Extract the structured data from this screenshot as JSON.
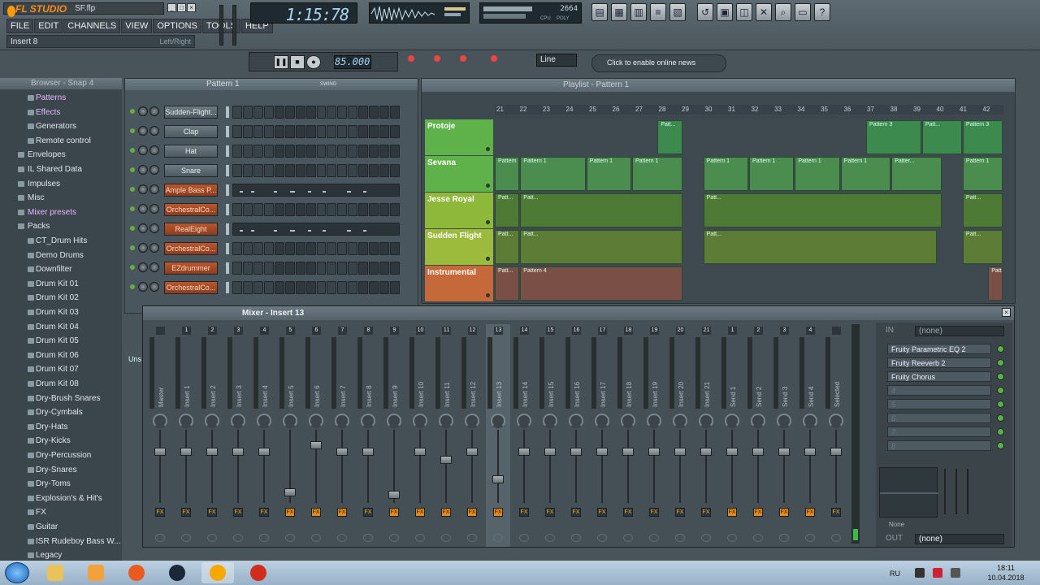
{
  "app": {
    "logo_text": "FL STUDIO",
    "file_name": "SF.flp",
    "menu": [
      "FILE",
      "EDIT",
      "CHANNELS",
      "VIEW",
      "OPTIONS",
      "TOOLS",
      "HELP"
    ],
    "hint_left": "Insert 8",
    "hint_right": "Left/Right",
    "time_display": "1:15:78",
    "memory": "2664",
    "cpu_label": "CPU",
    "poly_label": "POLY",
    "tempo": "85.000",
    "snap_mode": "Line",
    "online_text": "Click to enable online news"
  },
  "browser": {
    "title": "Browser - Snap 4",
    "items": [
      {
        "label": "Patterns",
        "level": 1,
        "hl": true
      },
      {
        "label": "Effects",
        "level": 1,
        "hl": true
      },
      {
        "label": "Generators",
        "level": 1,
        "hl": false
      },
      {
        "label": "Remote control",
        "level": 1,
        "hl": false
      },
      {
        "label": "Envelopes",
        "level": 0,
        "hl": false
      },
      {
        "label": "IL Shared Data",
        "level": 0,
        "hl": false
      },
      {
        "label": "Impulses",
        "level": 0,
        "hl": false
      },
      {
        "label": "Misc",
        "level": 0,
        "hl": false
      },
      {
        "label": "Mixer presets",
        "level": 0,
        "hl": true
      },
      {
        "label": "Packs",
        "level": 0,
        "hl": false
      },
      {
        "label": "CT_Drum Hits",
        "level": 1,
        "hl": false
      },
      {
        "label": "Demo Drums",
        "level": 1,
        "hl": false
      },
      {
        "label": "Downfilter",
        "level": 1,
        "hl": false
      },
      {
        "label": "Drum Kit 01",
        "level": 1,
        "hl": false
      },
      {
        "label": "Drum Kit 02",
        "level": 1,
        "hl": false
      },
      {
        "label": "Drum Kit 03",
        "level": 1,
        "hl": false
      },
      {
        "label": "Drum Kit 04",
        "level": 1,
        "hl": false
      },
      {
        "label": "Drum Kit 05",
        "level": 1,
        "hl": false
      },
      {
        "label": "Drum Kit 06",
        "level": 1,
        "hl": false
      },
      {
        "label": "Drum Kit 07",
        "level": 1,
        "hl": false
      },
      {
        "label": "Drum Kit 08",
        "level": 1,
        "hl": false
      },
      {
        "label": "Dry-Brush Snares",
        "level": 1,
        "hl": false
      },
      {
        "label": "Dry-Cymbals",
        "level": 1,
        "hl": false
      },
      {
        "label": "Dry-Hats",
        "level": 1,
        "hl": false
      },
      {
        "label": "Dry-Kicks",
        "level": 1,
        "hl": false
      },
      {
        "label": "Dry-Percussion",
        "level": 1,
        "hl": false
      },
      {
        "label": "Dry-Snares",
        "level": 1,
        "hl": false
      },
      {
        "label": "Dry-Toms",
        "level": 1,
        "hl": false
      },
      {
        "label": "Explosion's & Hit's",
        "level": 1,
        "hl": false
      },
      {
        "label": "FX",
        "level": 1,
        "hl": false
      },
      {
        "label": "Guitar",
        "level": 1,
        "hl": false
      },
      {
        "label": "ISR Rudeboy Bass W...",
        "level": 1,
        "hl": false
      },
      {
        "label": "Legacy",
        "level": 1,
        "hl": false
      }
    ]
  },
  "channel_rack": {
    "title": "Pattern 1",
    "swing_label": "SWING",
    "unsorted_label": "Uns",
    "channels": [
      {
        "name": "Sudden-Flight...",
        "plugin": false,
        "roll": false
      },
      {
        "name": "Clap",
        "plugin": false,
        "roll": false
      },
      {
        "name": "Hat",
        "plugin": false,
        "roll": false
      },
      {
        "name": "Snare",
        "plugin": false,
        "roll": false
      },
      {
        "name": "Ample Bass P...",
        "plugin": true,
        "roll": true
      },
      {
        "name": "OrchestralCo...",
        "plugin": true,
        "roll": false
      },
      {
        "name": "RealEight",
        "plugin": true,
        "roll": true
      },
      {
        "name": "OrchestralCo...",
        "plugin": true,
        "roll": false
      },
      {
        "name": "EZdrummer",
        "plugin": true,
        "roll": false
      },
      {
        "name": "OrchestralCo...",
        "plugin": true,
        "roll": false
      }
    ]
  },
  "playlist": {
    "title": "Playlist - Pattern 1",
    "ruler": [
      "21",
      "22",
      "23",
      "24",
      "25",
      "26",
      "27",
      "28",
      "29",
      "30",
      "31",
      "32",
      "33",
      "34",
      "35",
      "36",
      "37",
      "38",
      "39",
      "40",
      "41",
      "42"
    ],
    "tracks": [
      {
        "name": "Protoje",
        "color": "#5fb24a",
        "clip_color": "#3d8a4e",
        "clips": [
          {
            "label": "Patt...",
            "start": 0.32,
            "end": 0.37
          },
          {
            "label": "Pattern 3",
            "start": 0.73,
            "end": 0.84
          },
          {
            "label": "Patt...",
            "start": 0.84,
            "end": 0.92
          },
          {
            "label": "Pattern 3",
            "start": 0.92,
            "end": 1.0
          }
        ]
      },
      {
        "name": "Sevana",
        "color": "#5fb24a",
        "clip_color": "#4a8d4e",
        "clips": [
          {
            "label": "Pattern 1",
            "start": 0.0,
            "end": 0.05
          },
          {
            "label": "Pattern 1",
            "start": 0.05,
            "end": 0.18
          },
          {
            "label": "Pattern 1",
            "start": 0.18,
            "end": 0.27
          },
          {
            "label": "Pattern 1",
            "start": 0.27,
            "end": 0.37
          },
          {
            "label": "Pattern 1",
            "start": 0.41,
            "end": 0.5
          },
          {
            "label": "Pattern 1",
            "start": 0.5,
            "end": 0.59
          },
          {
            "label": "Pattern 1",
            "start": 0.59,
            "end": 0.68
          },
          {
            "label": "Pattern 1",
            "start": 0.68,
            "end": 0.78
          },
          {
            "label": "Patter...",
            "start": 0.78,
            "end": 0.88
          },
          {
            "label": "Pattern 1",
            "start": 0.92,
            "end": 1.0
          }
        ]
      },
      {
        "name": "Jesse Royal",
        "color": "#8db83a",
        "clip_color": "#4d7a34",
        "clips": [
          {
            "label": "Patt...",
            "start": 0.0,
            "end": 0.05
          },
          {
            "label": "Patt...",
            "start": 0.05,
            "end": 0.37
          },
          {
            "label": "Patt...",
            "start": 0.41,
            "end": 0.88
          },
          {
            "label": "Patt...",
            "start": 0.92,
            "end": 1.0
          }
        ]
      },
      {
        "name": "Sudden Flight",
        "color": "#9cbb3c",
        "clip_color": "#5d7d36",
        "clips": [
          {
            "label": "Patt...",
            "start": 0.0,
            "end": 0.05
          },
          {
            "label": "Patt...",
            "start": 0.05,
            "end": 0.37
          },
          {
            "label": "Patt...",
            "start": 0.41,
            "end": 0.87
          },
          {
            "label": "Patt...",
            "start": 0.92,
            "end": 1.0
          }
        ]
      },
      {
        "name": "Instrumental",
        "color": "#c5683a",
        "clip_color": "#7a5046",
        "clips": [
          {
            "label": "Patt...",
            "start": 0.0,
            "end": 0.05
          },
          {
            "label": "Pattern 4",
            "start": 0.05,
            "end": 0.37
          },
          {
            "label": "Patte",
            "start": 0.97,
            "end": 1.0
          }
        ]
      }
    ]
  },
  "mixer": {
    "title": "Mixer - Insert 13",
    "strips": [
      {
        "num": "",
        "label": "Master",
        "fader": 0.72,
        "send": false
      },
      {
        "num": "1",
        "label": "Insert 1",
        "fader": 0.72,
        "send": false
      },
      {
        "num": "2",
        "label": "Insert 2",
        "fader": 0.72,
        "send": false
      },
      {
        "num": "3",
        "label": "Insert 3",
        "fader": 0.72,
        "send": false
      },
      {
        "num": "4",
        "label": "Insert 4",
        "fader": 0.72,
        "send": false
      },
      {
        "num": "5",
        "label": "Insert 5",
        "fader": 0.1,
        "send": true
      },
      {
        "num": "6",
        "label": "Insert 6",
        "fader": 0.82,
        "send": true
      },
      {
        "num": "7",
        "label": "Insert 7",
        "fader": 0.72,
        "send": true
      },
      {
        "num": "8",
        "label": "Insert 8",
        "fader": 0.72,
        "send": false
      },
      {
        "num": "9",
        "label": "Insert 9",
        "fader": 0.06,
        "send": true
      },
      {
        "num": "10",
        "label": "Insert 10",
        "fader": 0.72,
        "send": true
      },
      {
        "num": "11",
        "label": "Insert 11",
        "fader": 0.6,
        "send": true
      },
      {
        "num": "12",
        "label": "Insert 12",
        "fader": 0.72,
        "send": true
      },
      {
        "num": "13",
        "label": "Insert 13",
        "fader": 0.3,
        "send": true
      },
      {
        "num": "14",
        "label": "Insert 14",
        "fader": 0.72,
        "send": false
      },
      {
        "num": "15",
        "label": "Insert 15",
        "fader": 0.72,
        "send": false
      },
      {
        "num": "16",
        "label": "Insert 16",
        "fader": 0.72,
        "send": false
      },
      {
        "num": "17",
        "label": "Insert 17",
        "fader": 0.72,
        "send": false
      },
      {
        "num": "18",
        "label": "Insert 18",
        "fader": 0.72,
        "send": false
      },
      {
        "num": "19",
        "label": "Insert 19",
        "fader": 0.72,
        "send": false
      },
      {
        "num": "20",
        "label": "Insert 20",
        "fader": 0.72,
        "send": false
      },
      {
        "num": "21",
        "label": "Insert 21",
        "fader": 0.72,
        "send": false
      },
      {
        "num": "1",
        "label": "Send 1",
        "fader": 0.72,
        "send": true
      },
      {
        "num": "2",
        "label": "Send 2",
        "fader": 0.72,
        "send": true
      },
      {
        "num": "3",
        "label": "Send 3",
        "fader": 0.72,
        "send": true
      },
      {
        "num": "4",
        "label": "Send 4",
        "fader": 0.72,
        "send": true
      },
      {
        "num": "",
        "label": "Selected",
        "fader": 0.72,
        "send": false
      }
    ],
    "fx_in_label": "IN",
    "fx_in_value": "(none)",
    "fx_slots": [
      "Fruity Parametric EQ 2",
      "Fruity Reeverb 2",
      "Fruity Chorus",
      "4",
      "5",
      "6",
      "7",
      "8"
    ],
    "eq_none": "None",
    "fx_out_label": "OUT",
    "fx_out_value": "(none)"
  },
  "taskbar": {
    "lang": "RU",
    "time": "18:11",
    "date": "10.04.2018"
  }
}
